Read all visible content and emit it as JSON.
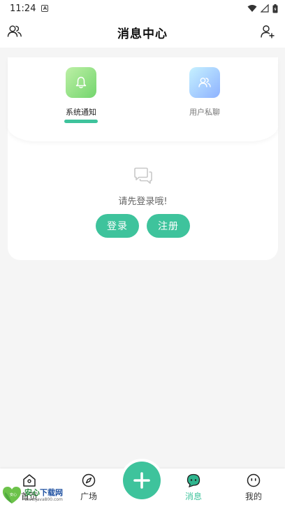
{
  "status_bar": {
    "time": "11:24",
    "notification_glyph": "A"
  },
  "header": {
    "title": "消息中心"
  },
  "tabs": [
    {
      "label": "系统通知",
      "icon": "bell-icon",
      "active": true
    },
    {
      "label": "用户私聊",
      "icon": "users-icon",
      "active": false
    }
  ],
  "empty_state": {
    "message": "请先登录哦!",
    "login_label": "登录",
    "register_label": "注册"
  },
  "bottom_nav": {
    "home_label": "首页",
    "plaza_label": "广场",
    "messages_label": "消息",
    "me_label": "我的"
  },
  "watermark": {
    "title_green": "安心",
    "title_blue": "下载网",
    "url": "www.java800.com",
    "badge": "安心"
  },
  "colors": {
    "accent": "#3ec39c",
    "background": "#f5f5f5",
    "card": "#ffffff"
  }
}
